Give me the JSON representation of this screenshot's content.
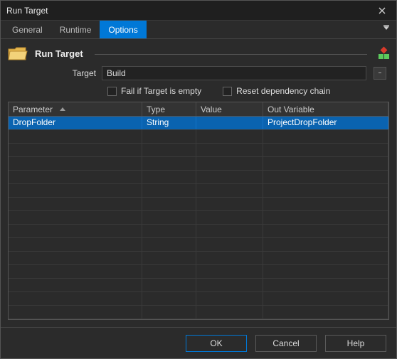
{
  "window": {
    "title": "Run Target"
  },
  "tabs": [
    {
      "label": "General",
      "active": false
    },
    {
      "label": "Runtime",
      "active": false
    },
    {
      "label": "Options",
      "active": true
    }
  ],
  "header": {
    "title": "Run Target"
  },
  "form": {
    "target_label": "Target",
    "target_value": "Build",
    "fail_if_empty_label": "Fail if Target is empty",
    "fail_if_empty_checked": false,
    "reset_chain_label": "Reset dependency chain",
    "reset_chain_checked": false
  },
  "grid": {
    "columns": {
      "parameter": "Parameter",
      "type": "Type",
      "value": "Value",
      "out_variable": "Out Variable"
    },
    "rows": [
      {
        "parameter": "DropFolder",
        "type": "String",
        "value": "",
        "out_variable": "ProjectDropFolder",
        "selected": true
      }
    ],
    "empty_row_count": 14
  },
  "buttons": {
    "ok": "OK",
    "cancel": "Cancel",
    "help": "Help"
  }
}
